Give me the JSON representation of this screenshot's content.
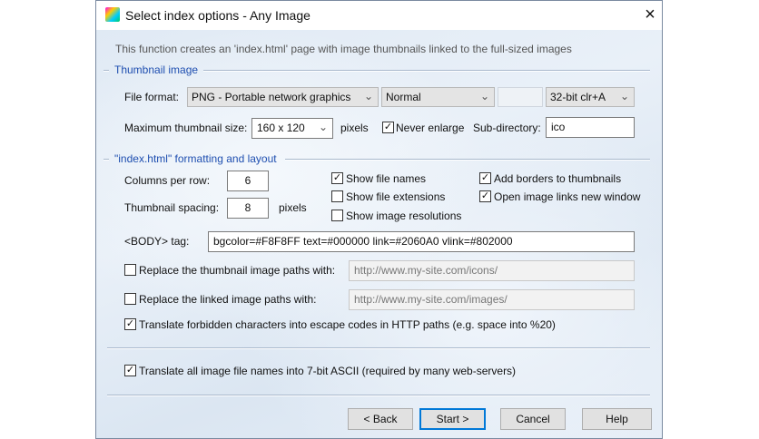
{
  "window": {
    "title": "Select index options - Any Image",
    "close_icon": "×"
  },
  "intro": "This function creates an 'index.html' page with image thumbnails linked to the full-sized images",
  "thumbnail_group": {
    "label": "Thumbnail image",
    "file_format_label": "File format:",
    "file_format": "PNG - Portable network graphics",
    "compression": "Normal",
    "blank_field": "",
    "color_depth": "32-bit clr+A",
    "max_size_label": "Maximum thumbnail size:",
    "max_size": "160 x 120",
    "pixels_label": "pixels",
    "never_enlarge": {
      "label": "Never enlarge",
      "checked": true
    },
    "subdir_label": "Sub-directory:",
    "subdir": "ico"
  },
  "layout_group": {
    "label": "\"index.html\" formatting and layout",
    "columns_label": "Columns per row:",
    "columns": "6",
    "spacing_label": "Thumbnail spacing:",
    "spacing": "8",
    "pixels_label": "pixels",
    "show_file_names": {
      "label": "Show file names",
      "checked": true
    },
    "show_file_extensions": {
      "label": "Show file extensions",
      "checked": false
    },
    "show_image_resolutions": {
      "label": "Show image resolutions",
      "checked": false
    },
    "add_borders": {
      "label": "Add borders to thumbnails",
      "checked": true
    },
    "open_new_window": {
      "label": "Open image links new window",
      "checked": true
    },
    "body_label": "<BODY> tag:",
    "body_value": "bgcolor=#F8F8FF text=#000000 link=#2060A0 vlink=#802000",
    "replace_thumb": {
      "label": "Replace the thumbnail image paths with:",
      "checked": false,
      "value": "http://www.my-site.com/icons/"
    },
    "replace_linked": {
      "label": "Replace the linked image paths with:",
      "checked": false,
      "value": "http://www.my-site.com/images/"
    },
    "translate_forbidden": {
      "label": "Translate forbidden characters into escape codes in HTTP paths (e.g. space into %20)",
      "checked": true
    }
  },
  "translate_ascii": {
    "label": "Translate all image file names into 7-bit ASCII (required by many web-servers)",
    "checked": true
  },
  "buttons": {
    "back": "< Back",
    "start": "Start >",
    "cancel": "Cancel",
    "help": "Help"
  },
  "check_glyph": "✓",
  "chevron": "⌄"
}
